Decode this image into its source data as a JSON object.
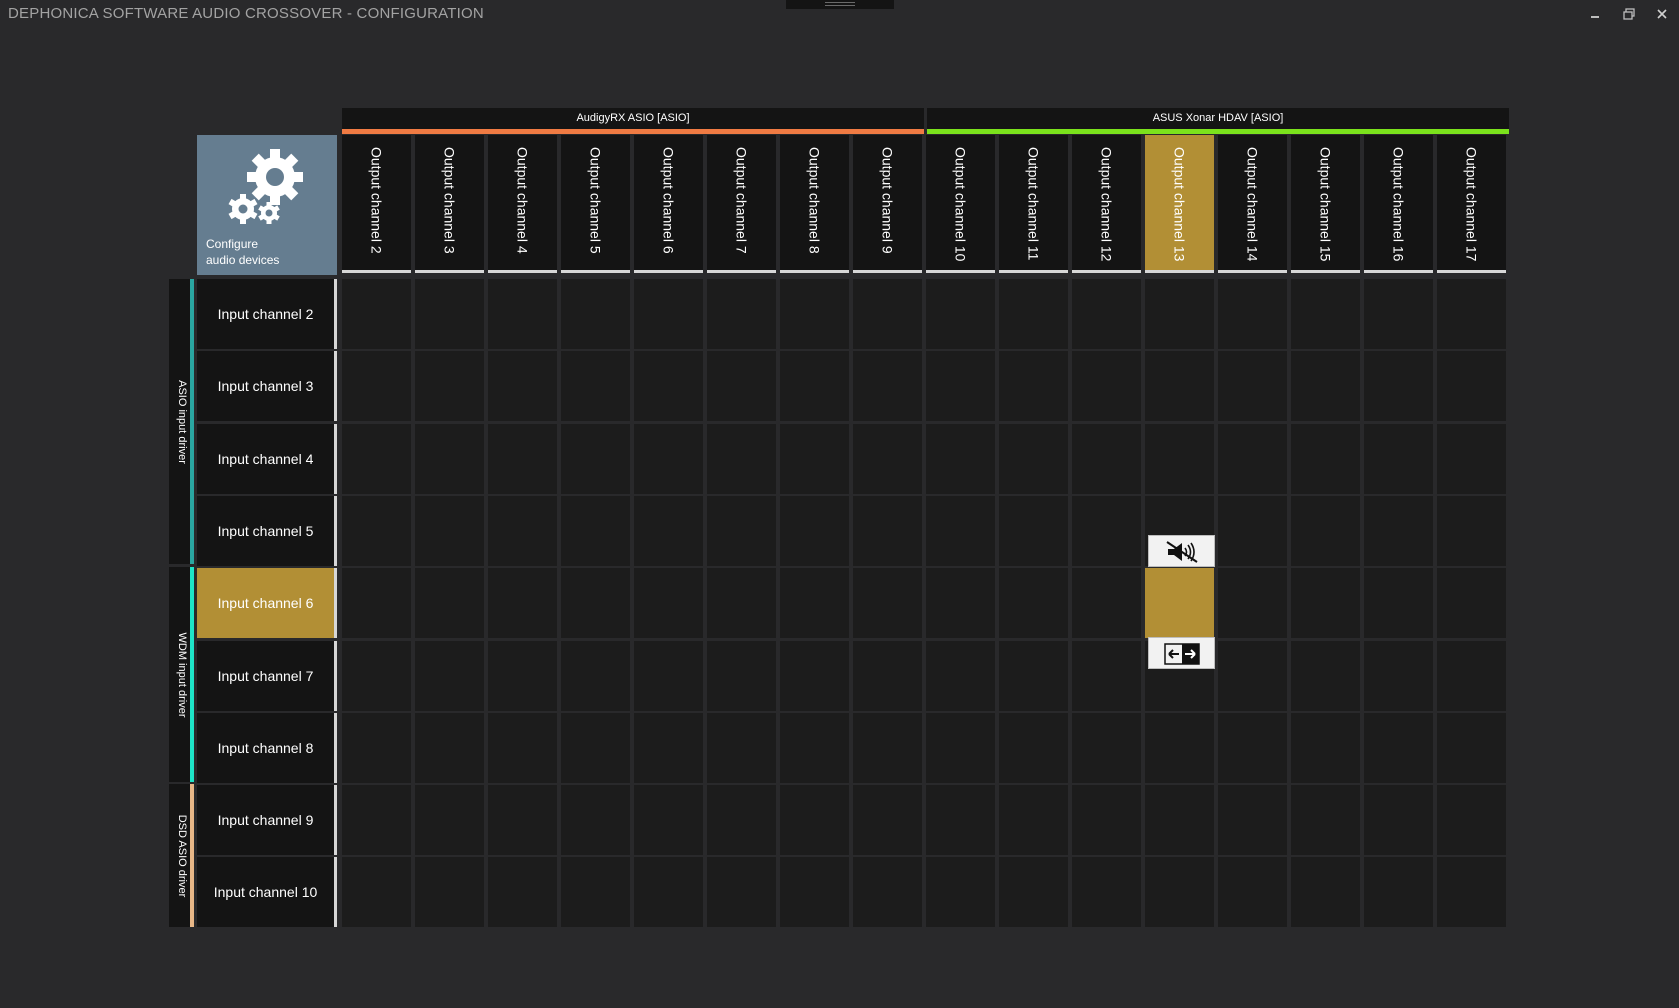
{
  "window": {
    "title": "DEPHONICA SOFTWARE AUDIO CROSSOVER - CONFIGURATION",
    "controls": [
      "minimize-icon",
      "restore-icon",
      "close-icon"
    ]
  },
  "config_tile": {
    "label": "Configure\naudio devices",
    "icon": "gears-icon"
  },
  "output_devices": [
    {
      "name": "AudigyRX ASIO [ASIO]",
      "color": "#f07b43",
      "channel_count": 8
    },
    {
      "name": "ASUS Xonar HDAV [ASIO]",
      "color": "#7be21c",
      "channel_count": 8
    }
  ],
  "output_channels": [
    "Output channel 2",
    "Output channel 3",
    "Output channel 4",
    "Output channel 5",
    "Output channel 6",
    "Output channel 7",
    "Output channel 8",
    "Output channel 9",
    "Output channel 10",
    "Output channel 11",
    "Output channel 12",
    "Output channel 13",
    "Output channel 14",
    "Output channel 15",
    "Output channel 16",
    "Output channel 17"
  ],
  "input_groups": [
    {
      "name": "ASIO input driver",
      "color": "#2aa6a1",
      "channel_count": 4
    },
    {
      "name": "WDM input driver",
      "color": "#1ee5c8",
      "channel_count": 3
    },
    {
      "name": "DSD ASIO driver",
      "color": "#e8b787",
      "channel_count": 2
    }
  ],
  "input_channels": [
    "Input channel 2",
    "Input channel 3",
    "Input channel 4",
    "Input channel 5",
    "Input channel 6",
    "Input channel 7",
    "Input channel 8",
    "Input channel 9",
    "Input channel 10"
  ],
  "selection": {
    "input": "Input channel 6",
    "output": "Output channel 13",
    "highlight_color": "#b28f35"
  },
  "cell_popup": {
    "buttons": [
      "mute-speaker-icon",
      "swap-arrows-icon"
    ]
  }
}
